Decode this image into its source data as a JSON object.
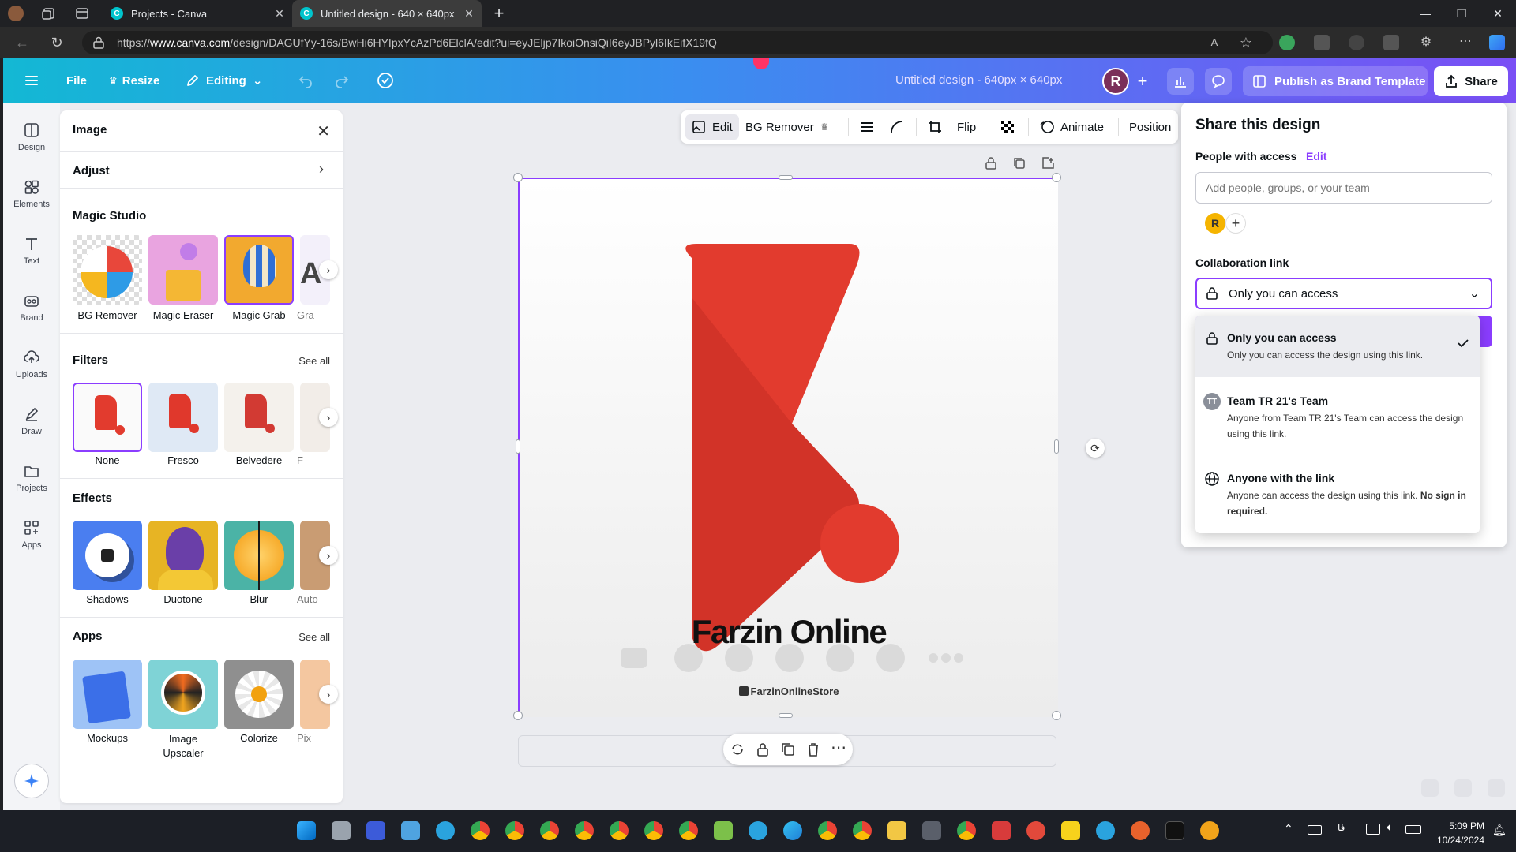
{
  "browser": {
    "tabs": [
      {
        "label": "Projects - Canva"
      },
      {
        "label": "Untitled design - 640 × 640px"
      }
    ],
    "url_prefix": "https://",
    "url_host": "www.canva.com",
    "url_path": "/design/DAGUfYy-16s/BwHi6HYIpxYcAzPd6ElclA/edit?ui=eyJEljp7IkoiOnsiQiI6eyJBPyl6IkEifX19fQ"
  },
  "header": {
    "file": "File",
    "resize": "Resize",
    "editing": "Editing",
    "doc_title": "Untitled design - 640px × 640px",
    "avatar": "R",
    "publish": "Publish as Brand Template",
    "share": "Share"
  },
  "rail": {
    "items": [
      {
        "label": "Design",
        "icon": "design-icon"
      },
      {
        "label": "Elements",
        "icon": "elements-icon"
      },
      {
        "label": "Text",
        "icon": "text-icon"
      },
      {
        "label": "Brand",
        "icon": "brand-icon"
      },
      {
        "label": "Uploads",
        "icon": "uploads-icon"
      },
      {
        "label": "Draw",
        "icon": "draw-icon"
      },
      {
        "label": "Projects",
        "icon": "projects-icon"
      },
      {
        "label": "Apps",
        "icon": "apps-icon"
      }
    ]
  },
  "panel": {
    "title": "Image",
    "adjust": "Adjust",
    "magic_studio": {
      "title": "Magic Studio",
      "items": [
        "BG Remover",
        "Magic Eraser",
        "Magic Grab",
        "Gra"
      ]
    },
    "filters": {
      "title": "Filters",
      "see_all": "See all",
      "items": [
        "None",
        "Fresco",
        "Belvedere",
        "F"
      ]
    },
    "effects": {
      "title": "Effects",
      "items": [
        "Shadows",
        "Duotone",
        "Blur",
        "Auto"
      ]
    },
    "apps": {
      "title": "Apps",
      "see_all": "See all",
      "items": [
        "Mockups",
        "Image Upscaler",
        "Colorize",
        "Pix"
      ]
    }
  },
  "toolbar": {
    "edit": "Edit",
    "bg_remover": "BG Remover",
    "flip": "Flip",
    "animate": "Animate",
    "position": "Position"
  },
  "canvas": {
    "brand_text": "Farzin Online",
    "brand_sub": "FarzinOnlineStore"
  },
  "share": {
    "title": "Share this design",
    "people_label": "People with access",
    "people_edit": "Edit",
    "add_placeholder": "Add people, groups, or your team",
    "mini_avatar": "R",
    "collab_label": "Collaboration link",
    "collab_value": "Only you can access",
    "options": [
      {
        "title": "Only you can access",
        "desc": "Only you can access the design using this link.",
        "selected": true
      },
      {
        "title": "Team TR 21's Team",
        "desc": "Anyone from Team TR 21's Team can access the design using this link.",
        "badge": "TT"
      },
      {
        "title": "Anyone with the link",
        "desc": "Anyone can access the design using this link.",
        "desc_bold": "No sign in required."
      }
    ]
  },
  "taskbar": {
    "time": "5:09 PM",
    "date": "10/24/2024"
  },
  "colors": {
    "accent": "#8b3dff",
    "logo_red": "#e23b2e",
    "header_start": "#13b8d4",
    "header_end": "#7a4ff5"
  }
}
